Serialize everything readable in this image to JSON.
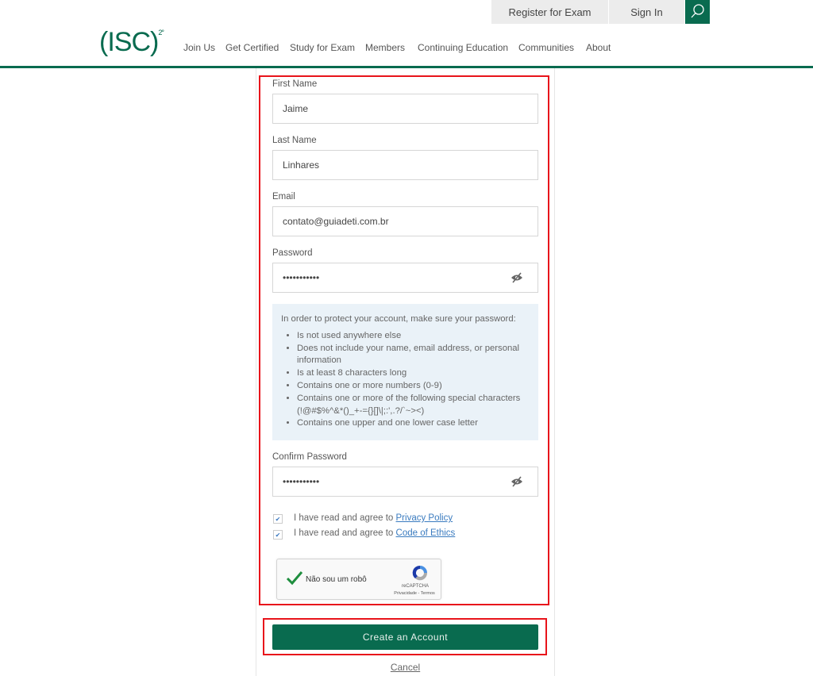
{
  "header": {
    "register_label": "Register for Exam",
    "signin_label": "Sign In",
    "logo_text": "(ISC)",
    "logo_sup": "2°",
    "nav": [
      "Join Us",
      "Get Certified",
      "Study for Exam",
      "Members",
      "Continuing Education",
      "Communities",
      "About"
    ]
  },
  "form": {
    "first_name": {
      "label": "First Name",
      "value": "Jaime"
    },
    "last_name": {
      "label": "Last Name",
      "value": "Linhares"
    },
    "email": {
      "label": "Email",
      "value": "contato@guiadeti.com.br"
    },
    "password": {
      "label": "Password",
      "value": "•••••••••••"
    },
    "info": {
      "intro": "In order to protect your account, make sure your password:",
      "items": [
        "Is not used anywhere else",
        "Does not include your name, email address, or personal information",
        "Is at least 8 characters long",
        "Contains one or more numbers (0-9)",
        "Contains one or more of the following special characters (!@#$%^&*()_+-={}[]\\|;:',.?/`~><)",
        "Contains one upper and one lower case letter"
      ]
    },
    "confirm": {
      "label": "Confirm Password",
      "value": "•••••••••••"
    },
    "agree_prefix": "I have read and agree to ",
    "privacy_link": "Privacy Policy",
    "ethics_link": "Code of Ethics",
    "privacy_checked": true,
    "ethics_checked": true,
    "captcha": {
      "label": "Não sou um robô",
      "brand": "reCAPTCHA",
      "links": "Privacidade - Termos",
      "checked": true
    },
    "submit_label": "Create an Account",
    "cancel_label": "Cancel"
  },
  "colors": {
    "brand_green": "#096b4f",
    "highlight_red": "#e8141b"
  }
}
